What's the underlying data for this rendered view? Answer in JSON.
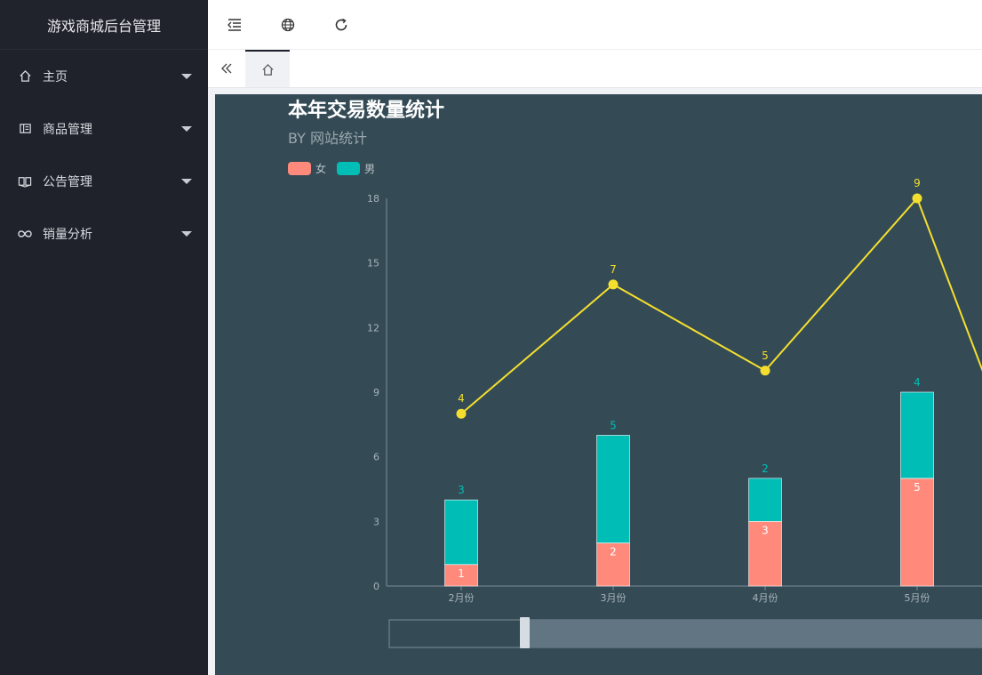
{
  "app": {
    "title": "游戏商城后台管理"
  },
  "sidebar": {
    "items": [
      {
        "label": "主页",
        "icon": "home-icon"
      },
      {
        "label": "商品管理",
        "icon": "goods-icon"
      },
      {
        "label": "公告管理",
        "icon": "book-icon"
      },
      {
        "label": "销量分析",
        "icon": "infinity-icon"
      }
    ]
  },
  "topbar": {
    "icons": [
      "menu-fold-icon",
      "globe-icon",
      "refresh-icon"
    ]
  },
  "tabs": {
    "icons": [
      "double-chevron-left-icon",
      "home-icon"
    ]
  },
  "colors": {
    "female": "#ff8a7b",
    "male": "#00bdb6",
    "line": "#f5df2e",
    "chart_bg": "#344b56",
    "sidebar_bg": "#1f222a"
  },
  "chart_data": {
    "type": "bar",
    "title": "本年交易数量统计",
    "subtitle": "BY 网站统计",
    "categories": [
      "2月份",
      "3月份",
      "4月份",
      "5月份"
    ],
    "stacked": true,
    "series": [
      {
        "name": "女",
        "type": "bar",
        "values": [
          1,
          2,
          3,
          5
        ]
      },
      {
        "name": "男",
        "type": "bar",
        "values": [
          3,
          5,
          2,
          4
        ]
      },
      {
        "type": "line",
        "values": [
          4,
          7,
          5,
          9
        ],
        "plotted_values": [
          8,
          14,
          10,
          18
        ]
      }
    ],
    "yticks": [
      0,
      3,
      6,
      9,
      12,
      15,
      18
    ],
    "ylim": [
      0,
      18
    ],
    "legend": "top-left",
    "datazoom": true
  }
}
